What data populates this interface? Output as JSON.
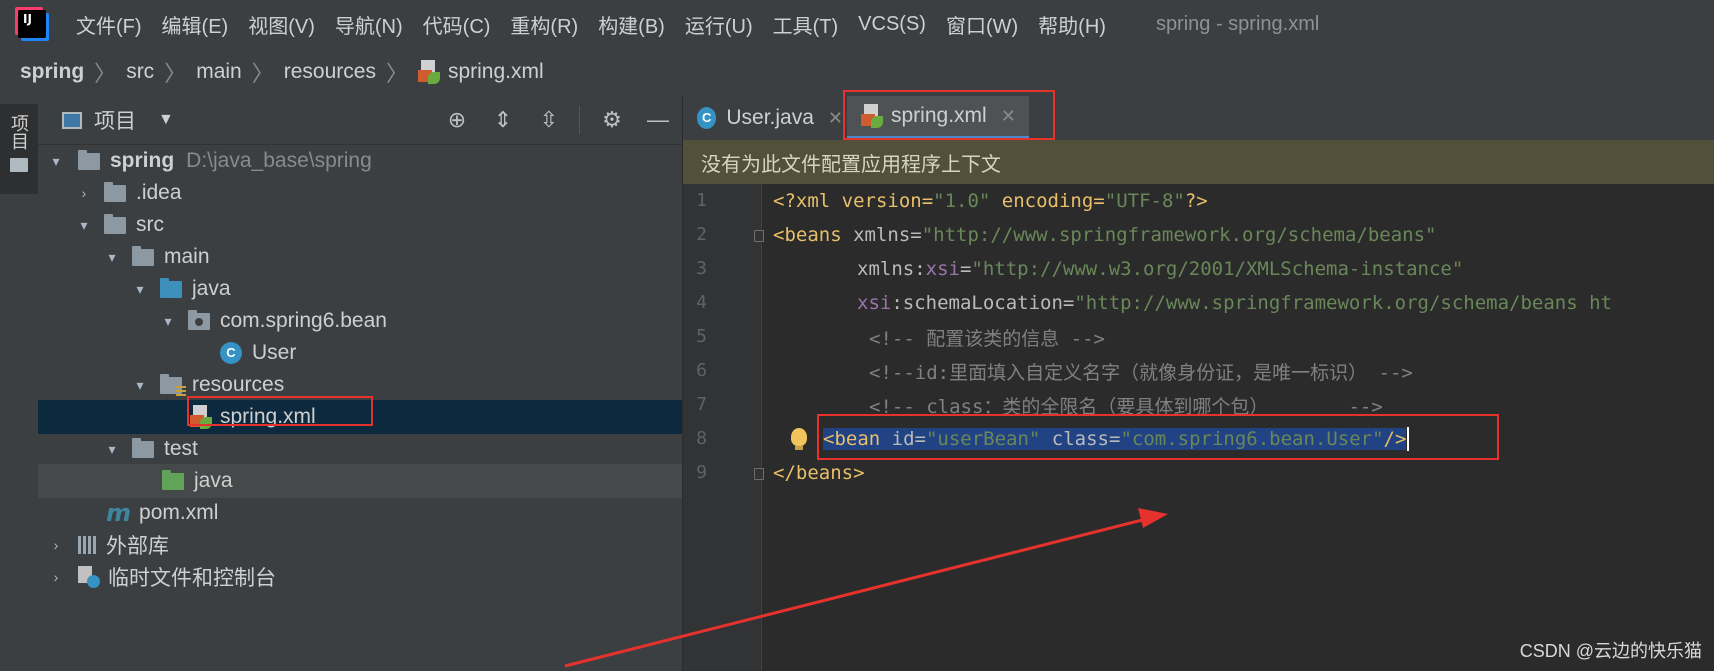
{
  "menubar": {
    "items": [
      "文件(F)",
      "编辑(E)",
      "视图(V)",
      "导航(N)",
      "代码(C)",
      "重构(R)",
      "构建(B)",
      "运行(U)",
      "工具(T)",
      "VCS(S)",
      "窗口(W)",
      "帮助(H)"
    ],
    "window_title": "spring - spring.xml",
    "logo_text": "IJ"
  },
  "breadcrumb": [
    "spring",
    "src",
    "main",
    "resources",
    "spring.xml"
  ],
  "tool_strip": {
    "project_label": "项目"
  },
  "project_panel": {
    "title": "项目",
    "tree": [
      {
        "label": "spring",
        "note": "D:\\java_base\\spring"
      },
      {
        "label": ".idea"
      },
      {
        "label": "src"
      },
      {
        "label": "main"
      },
      {
        "label": "java"
      },
      {
        "label": "com.spring6.bean"
      },
      {
        "label": "User",
        "icon_letter": "C"
      },
      {
        "label": "resources"
      },
      {
        "label": "spring.xml"
      },
      {
        "label": "test"
      },
      {
        "label": "java"
      },
      {
        "label": "pom.xml",
        "icon_letter": "m"
      },
      {
        "label": "外部库"
      },
      {
        "label": "临时文件和控制台"
      }
    ]
  },
  "editor": {
    "tabs": [
      {
        "label": "User.java",
        "icon_letter": "C"
      },
      {
        "label": "spring.xml"
      }
    ],
    "context_banner": "没有为此文件配置应用程序上下文",
    "line_numbers": [
      "1",
      "2",
      "3",
      "4",
      "5",
      "6",
      "7",
      "8",
      "9"
    ],
    "code": {
      "l1": {
        "a": "<?xml version=",
        "b": "\"1.0\"",
        "c": " encoding=",
        "d": "\"UTF-8\"",
        "e": "?>"
      },
      "l2": {
        "a": "<beans ",
        "b": "xmlns=",
        "c": "\"http://www.springframework.org/schema/beans\""
      },
      "l3": {
        "a": "xmlns:",
        "b": "xsi",
        "c": "=",
        "d": "\"http://www.w3.org/2001/XMLSchema-instance\""
      },
      "l4": {
        "a": "xsi",
        "b": ":schemaLocation=",
        "c": "\"http://www.springframework.org/schema/beans ht"
      },
      "l5": "<!-- 配置该类的信息 -->",
      "l6": "<!--id:里面填入自定义名字（就像身份证，是唯一标识） -->",
      "l7": "<!-- class：类的全限名（要具体到哪个包）       -->",
      "l8": {
        "a": "<bean ",
        "b": "id=",
        "c": "\"userBean\"",
        "d": " class=",
        "e": "\"com.spring6.bean.User\"",
        "f": "/>"
      },
      "l9": "</beans>"
    }
  },
  "watermark": "CSDN @云边的快乐猫",
  "colors": {
    "annotation_red": "#e5322d",
    "selection": "#214283",
    "banner": "#52503a"
  }
}
